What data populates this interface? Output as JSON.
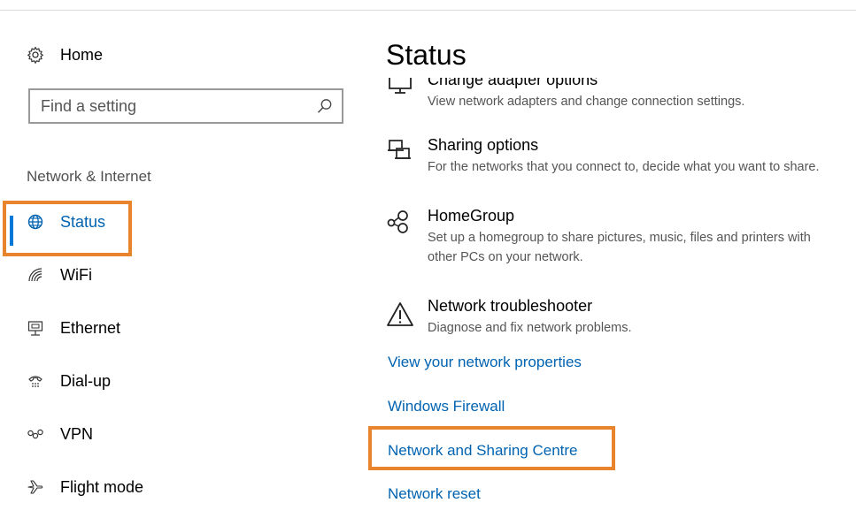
{
  "sidebar": {
    "home_label": "Home",
    "search_placeholder": "Find a setting",
    "section_title": "Network & Internet",
    "items": [
      {
        "label": "Status",
        "icon": "globe-icon"
      },
      {
        "label": "WiFi",
        "icon": "wifi-icon"
      },
      {
        "label": "Ethernet",
        "icon": "ethernet-icon"
      },
      {
        "label": "Dial-up",
        "icon": "dialup-icon"
      },
      {
        "label": "VPN",
        "icon": "vpn-icon"
      },
      {
        "label": "Flight mode",
        "icon": "airplane-icon"
      }
    ]
  },
  "main": {
    "title": "Status",
    "options": [
      {
        "title": "Change adapter options",
        "description": "View network adapters and change connection settings."
      },
      {
        "title": "Sharing options",
        "description": "For the networks that you connect to, decide what you want to share."
      },
      {
        "title": "HomeGroup",
        "description_line1": "Set up a homegroup to share pictures, music, files and printers with",
        "description_line2": "other PCs on your network."
      },
      {
        "title": "Network troubleshooter",
        "description": "Diagnose and fix network problems."
      }
    ],
    "links": [
      "View your network properties",
      "Windows Firewall",
      "Network and Sharing Centre",
      "Network reset"
    ]
  },
  "colors": {
    "accent": "#0078d7",
    "link": "#0063b1",
    "highlight": "#e8832e"
  }
}
